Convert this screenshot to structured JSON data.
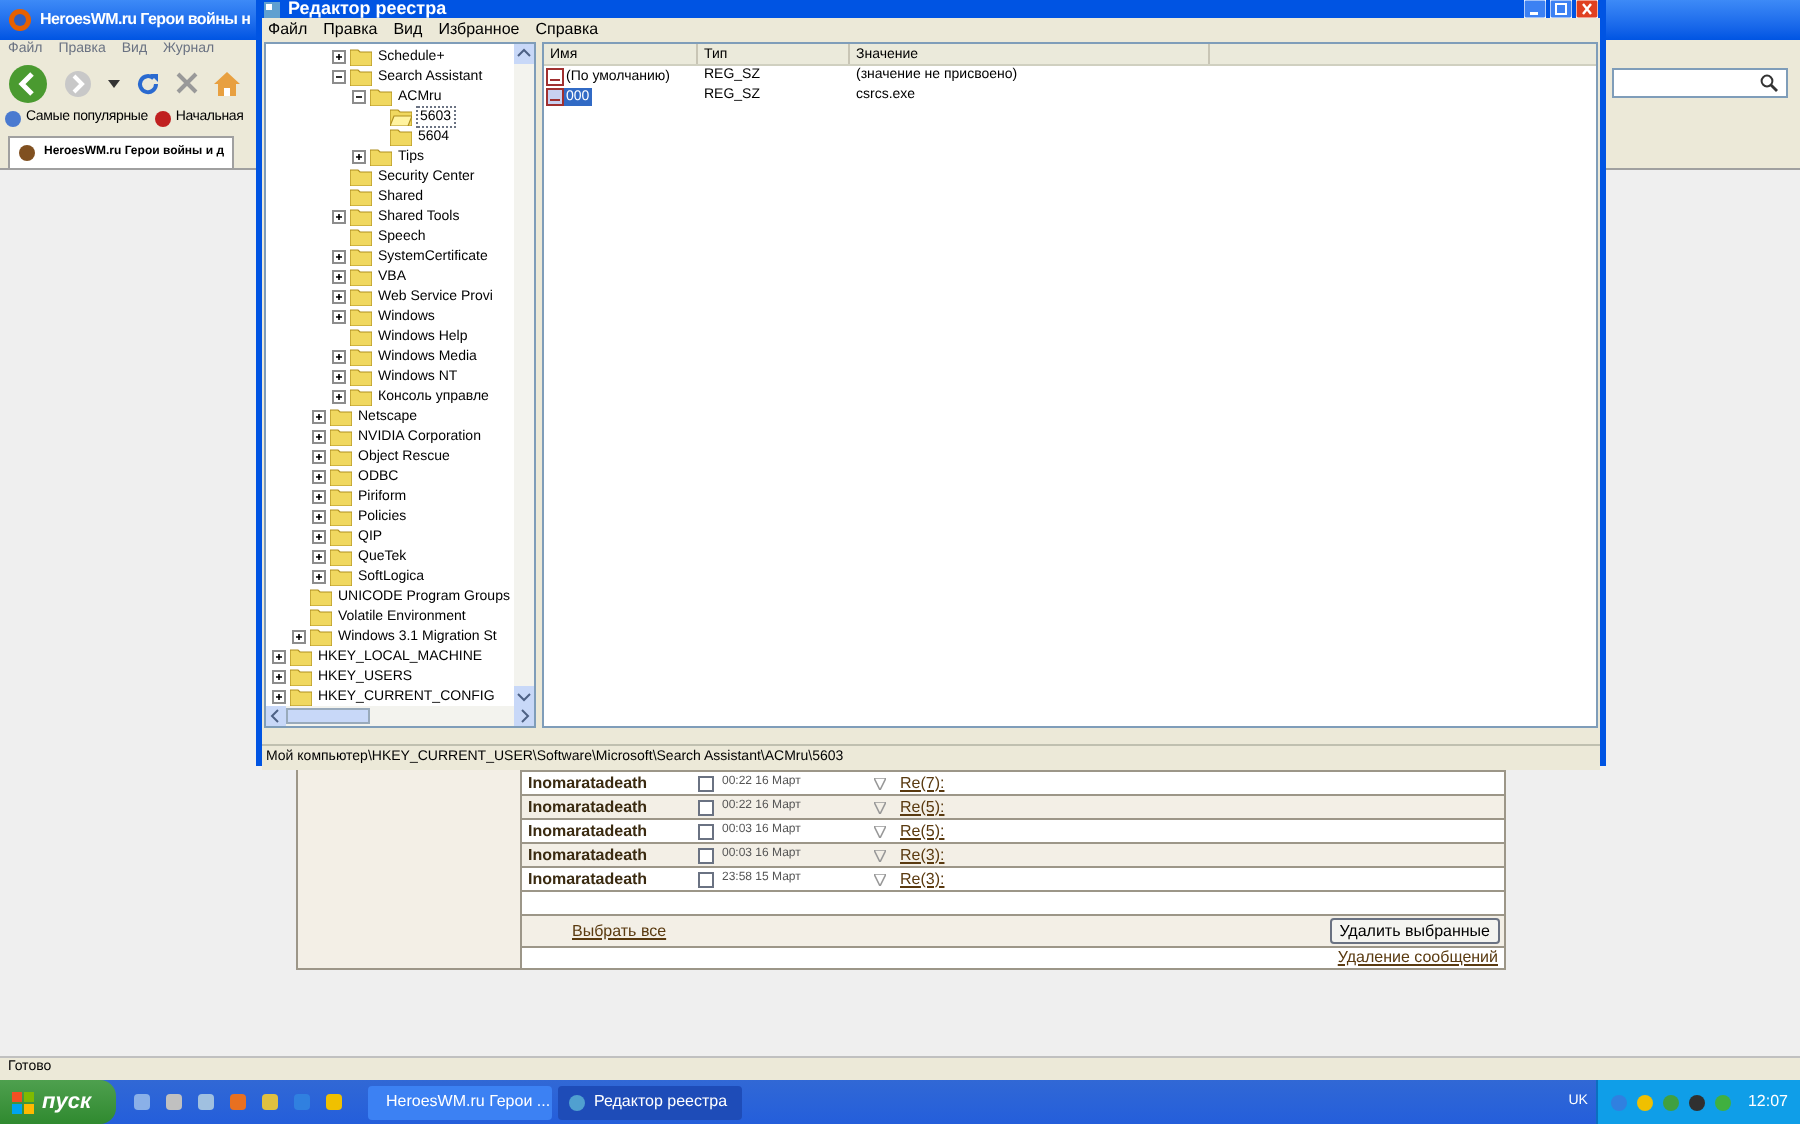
{
  "browser": {
    "title": "HeroesWM.ru Герои войны н",
    "menu": [
      "Файл",
      "Правка",
      "Вид",
      "Журнал"
    ],
    "bookmarks": [
      "Самые популярные",
      "Начальная"
    ],
    "tabs": [
      {
        "label": "HeroesWM.ru Герои войны и д",
        "selected": true
      }
    ],
    "messages": [
      {
        "sender": "Inomaratadeath",
        "checked": false,
        "time": "00:22 16 Март",
        "subject": "Re(7):"
      },
      {
        "sender": "Inomaratadeath",
        "checked": false,
        "time": "00:22 16 Март",
        "subject": "Re(5):"
      },
      {
        "sender": "Inomaratadeath",
        "checked": false,
        "time": "00:03 16 Март",
        "subject": "Re(5):"
      },
      {
        "sender": "Inomaratadeath",
        "checked": false,
        "time": "00:03 16 Март",
        "subject": "Re(3):"
      },
      {
        "sender": "Inomaratadeath",
        "checked": false,
        "time": "23:58 15 Март",
        "subject": "Re(3):"
      }
    ],
    "select_all": "Выбрать все",
    "delete_button": "Удалить выбранные",
    "delete_link": "Удаление сообщений",
    "status_bar": "Готово"
  },
  "registry": {
    "title": "Редактор реестра",
    "menu": [
      "Файл",
      "Правка",
      "Вид",
      "Избранное",
      "Справка"
    ],
    "tree": [
      {
        "children": [
          {
            "children": [
              {
                "children": [
                  {
                    "label": "Schedule+",
                    "expanded": false,
                    "selected": false
                  },
                  {
                    "label": "Search Assistant",
                    "expanded": true,
                    "selected": false,
                    "children": [
                      {
                        "label": "ACMru",
                        "expanded": true,
                        "selected": false,
                        "children": [
                          {
                            "label": "5603",
                            "selected": true
                          },
                          {
                            "label": "5604",
                            "selected": false
                          }
                        ]
                      },
                      {
                        "label": "Tips",
                        "expanded": false,
                        "selected": false
                      }
                    ]
                  },
                  {
                    "label": "Security Center",
                    "selected": false
                  },
                  {
                    "label": "Shared",
                    "selected": false
                  },
                  {
                    "label": "Shared Tools",
                    "expanded": false,
                    "selected": false
                  },
                  {
                    "label": "Speech",
                    "selected": false
                  },
                  {
                    "label": "SystemCertificate",
                    "expanded": false,
                    "selected": false
                  },
                  {
                    "label": "VBA",
                    "expanded": false,
                    "selected": false
                  },
                  {
                    "label": "Web Service Provi",
                    "expanded": false,
                    "selected": false
                  },
                  {
                    "label": "Windows",
                    "expanded": false,
                    "selected": false
                  },
                  {
                    "label": "Windows Help",
                    "selected": false
                  },
                  {
                    "label": "Windows Media",
                    "expanded": false,
                    "selected": false
                  },
                  {
                    "label": "Windows NT",
                    "expanded": false,
                    "selected": false
                  },
                  {
                    "label": "Консоль управле",
                    "expanded": false,
                    "selected": false
                  }
                ]
              },
              {
                "label": "Netscape",
                "expanded": false,
                "selected": false
              },
              {
                "label": "NVIDIA Corporation",
                "expanded": false,
                "selected": false
              },
              {
                "label": "Object Rescue",
                "expanded": false,
                "selected": false
              },
              {
                "label": "ODBC",
                "expanded": false,
                "selected": false
              },
              {
                "label": "Piriform",
                "expanded": false,
                "selected": false
              },
              {
                "label": "Policies",
                "expanded": false,
                "selected": false
              },
              {
                "label": "QIP",
                "expanded": false,
                "selected": false
              },
              {
                "label": "QueTek",
                "expanded": false,
                "selected": false
              },
              {
                "label": "SoftLogica",
                "expanded": false,
                "selected": false
              }
            ]
          },
          {
            "label": "UNICODE Program Groups",
            "selected": false
          },
          {
            "label": "Volatile Environment",
            "selected": false
          },
          {
            "label": "Windows 3.1 Migration St",
            "expanded": false,
            "selected": false
          }
        ]
      },
      {
        "label": "HKEY_LOCAL_MACHINE",
        "expanded": false,
        "selected": false
      },
      {
        "label": "HKEY_USERS",
        "expanded": false,
        "selected": false
      },
      {
        "label": "HKEY_CURRENT_CONFIG",
        "expanded": false,
        "selected": false
      }
    ],
    "columns": [
      "Имя",
      "Тип",
      "Значение"
    ],
    "values": [
      {
        "name": "(По умолчанию)",
        "type": "REG_SZ",
        "value": "(значение не присвоено)",
        "selected": false
      },
      {
        "name": "000",
        "type": "REG_SZ",
        "value": "csrcs.exe",
        "selected": true
      }
    ],
    "status_bar": "Мой компьютер\\HKEY_CURRENT_USER\\Software\\Microsoft\\Search Assistant\\ACMru\\5603"
  },
  "taskbar": {
    "start": "пуск",
    "tasks": [
      {
        "label": "HeroesWM.ru Герои ...",
        "selected": false
      },
      {
        "label": "Редактор реестра",
        "selected": true
      }
    ],
    "language": "UK",
    "clock": "12:07"
  }
}
